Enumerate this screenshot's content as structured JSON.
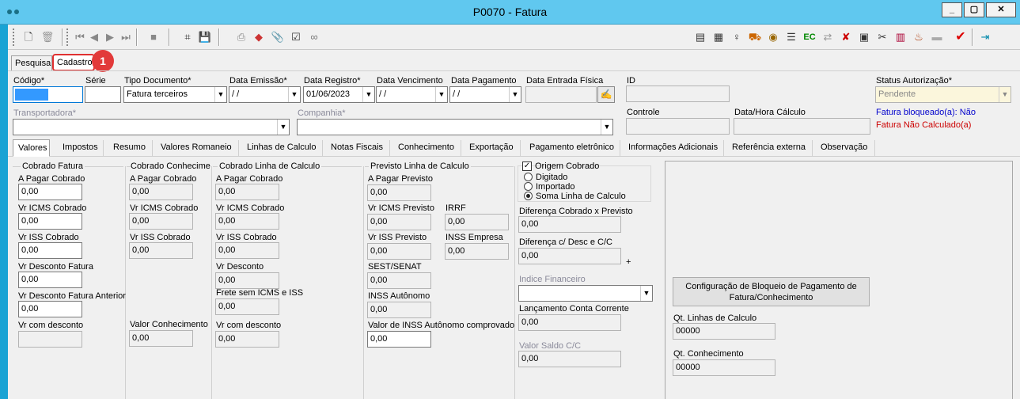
{
  "window": {
    "title": "P0070 - Fatura",
    "min": "_",
    "max": "▢",
    "close": "✕"
  },
  "toolbar": {
    "new_icon": "document-new-icon",
    "delete_icon": "trash-icon",
    "first_icon": "first-record-icon",
    "prev_icon": "previous-record-icon",
    "next_icon": "next-record-icon",
    "last_icon": "last-record-icon",
    "stop_icon": "stop-icon",
    "search_icon": "binoculars-icon",
    "save_icon": "floppy-disk-icon",
    "print_icon": "printer-icon",
    "attach_icon": "paperclip-icon",
    "link_icon": "chain-link-icon",
    "right_icons": [
      "database-icon",
      "calendar-icon",
      "key-icon",
      "truck-icon",
      "car-icon",
      "list-icon",
      "ec-icon",
      "arrows-icon",
      "cancel-icon",
      "screen-icon",
      "tools-icon",
      "folder-icon",
      "alarm-icon",
      "trailer-icon",
      "check-icon",
      "exit-icon"
    ],
    "ec_label": "EC"
  },
  "main_tabs": [
    {
      "label": "Pesquisa"
    },
    {
      "label": "Cadastro"
    }
  ],
  "badge": "1",
  "header": {
    "codigo_label": "Código*",
    "codigo_value": "",
    "serie_label": "Série",
    "serie_value": "",
    "tipo_label": "Tipo Documento*",
    "tipo_value": "Fatura terceiros",
    "emissao_label": "Data Emissão*",
    "emissao_value": " /  /",
    "registro_label": "Data Registro*",
    "registro_value": "01/06/2023",
    "vencimento_label": "Data Vencimento",
    "vencimento_value": " /  /",
    "pagamento_label": "Data Pagamento",
    "pagamento_value": " /  /",
    "entrada_label": "Data Entrada Física",
    "entrada_value": "",
    "id_label": "ID",
    "id_value": "",
    "status_label": "Status Autorização*",
    "status_value": "Pendente",
    "transportadora_label": "Transportadora*",
    "transportadora_value": "",
    "companhia_label": "Companhia*",
    "companhia_value": "",
    "controle_label": "Controle",
    "controle_value": "",
    "calculo_label": "Data/Hora Cálculo",
    "calculo_value": "",
    "bloqueio_text": "Fatura bloqueado(a): Não",
    "calculado_text": "Fatura Não Calculado(a)"
  },
  "sub_tabs": [
    {
      "label": "Valores"
    },
    {
      "label": "Impostos"
    },
    {
      "label": "Resumo"
    },
    {
      "label": "Valores Romaneio"
    },
    {
      "label": "Linhas de Calculo"
    },
    {
      "label": "Notas Fiscais"
    },
    {
      "label": "Conhecimento"
    },
    {
      "label": "Exportação"
    },
    {
      "label": "Pagamento eletrônico"
    },
    {
      "label": "Informações Adicionais"
    },
    {
      "label": "Referência externa"
    },
    {
      "label": "Observação"
    }
  ],
  "cobrado_fatura": {
    "title": "Cobrado Fatura",
    "a_pagar_label": "A Pagar Cobrado",
    "a_pagar": "0,00",
    "icms_label": "Vr ICMS Cobrado",
    "icms": "0,00",
    "iss_label": "Vr ISS Cobrado",
    "iss": "0,00",
    "desconto_label": "Vr Desconto Fatura",
    "desconto": "0,00",
    "desc_ant_label": "Vr Desconto Fatura Anterior",
    "desc_ant": "0,00",
    "com_desc_label": "Vr com desconto",
    "com_desc": ""
  },
  "cobrado_conhecimento": {
    "title": "Cobrado Conhecimer",
    "a_pagar_label": "A Pagar Cobrado",
    "a_pagar": "0,00",
    "icms_label": "Vr ICMS Cobrado",
    "icms": "0,00",
    "iss_label": "Vr ISS Cobrado",
    "iss": "0,00",
    "valor_label": "Valor Conhecimento",
    "valor": "0,00"
  },
  "cobrado_linha": {
    "title": "Cobrado Linha de Calculo",
    "a_pagar_label": "A Pagar Cobrado",
    "a_pagar": "0,00",
    "icms_label": "Vr ICMS Cobrado",
    "icms": "0,00",
    "iss_label": "Vr ISS Cobrado",
    "iss": "0,00",
    "desconto_label": "Vr Desconto",
    "desconto": "0,00",
    "frete_label": "Frete sem ICMS e ISS",
    "frete": "0,00",
    "com_desc_label": "Vr com desconto",
    "com_desc": "0,00"
  },
  "previsto": {
    "title": "Previsto Linha de Calculo",
    "a_pagar_label": "A Pagar Previsto",
    "a_pagar": "0,00",
    "icms_label": "Vr ICMS Previsto",
    "icms": "0,00",
    "irrf_label": "IRRF",
    "irrf": "0,00",
    "iss_label": "Vr ISS Previsto",
    "iss": "0,00",
    "iss_emp_label": "INSS Empresa",
    "iss_emp": "0,00",
    "sest_label": "SEST/SENAT",
    "sest": "0,00",
    "inss_aut_label": "INSS Autônomo",
    "inss_aut": "0,00",
    "inss_comp_label": "Valor de INSS Autônomo comprovado",
    "inss_comp": "0,00"
  },
  "origem": {
    "label": "Origem Cobrado",
    "checked": "✓",
    "digitado": "Digitado",
    "importado": "Importado",
    "soma": "Soma Linha de Calculo"
  },
  "diferencas": {
    "cob_prev_label": "Diferença Cobrado x Previsto",
    "cob_prev": "0,00",
    "desc_label": "Diferença  c/ Desc e C/C",
    "desc": "0,00",
    "plus": "+",
    "indice_label": "Indice Financeiro",
    "indice": "",
    "lanc_label": "Lançamento Conta Corrente",
    "lanc": "0,00",
    "saldo_label": "Valor Saldo C/C",
    "saldo": "0,00"
  },
  "config": {
    "button": "Configuração de Bloqueio de Pagamento de Fatura/Conhecimento",
    "linhas_label": "Qt. Linhas de Calculo",
    "linhas": "00000",
    "conhec_label": "Qt. Conhecimento",
    "conhec": "00000"
  }
}
